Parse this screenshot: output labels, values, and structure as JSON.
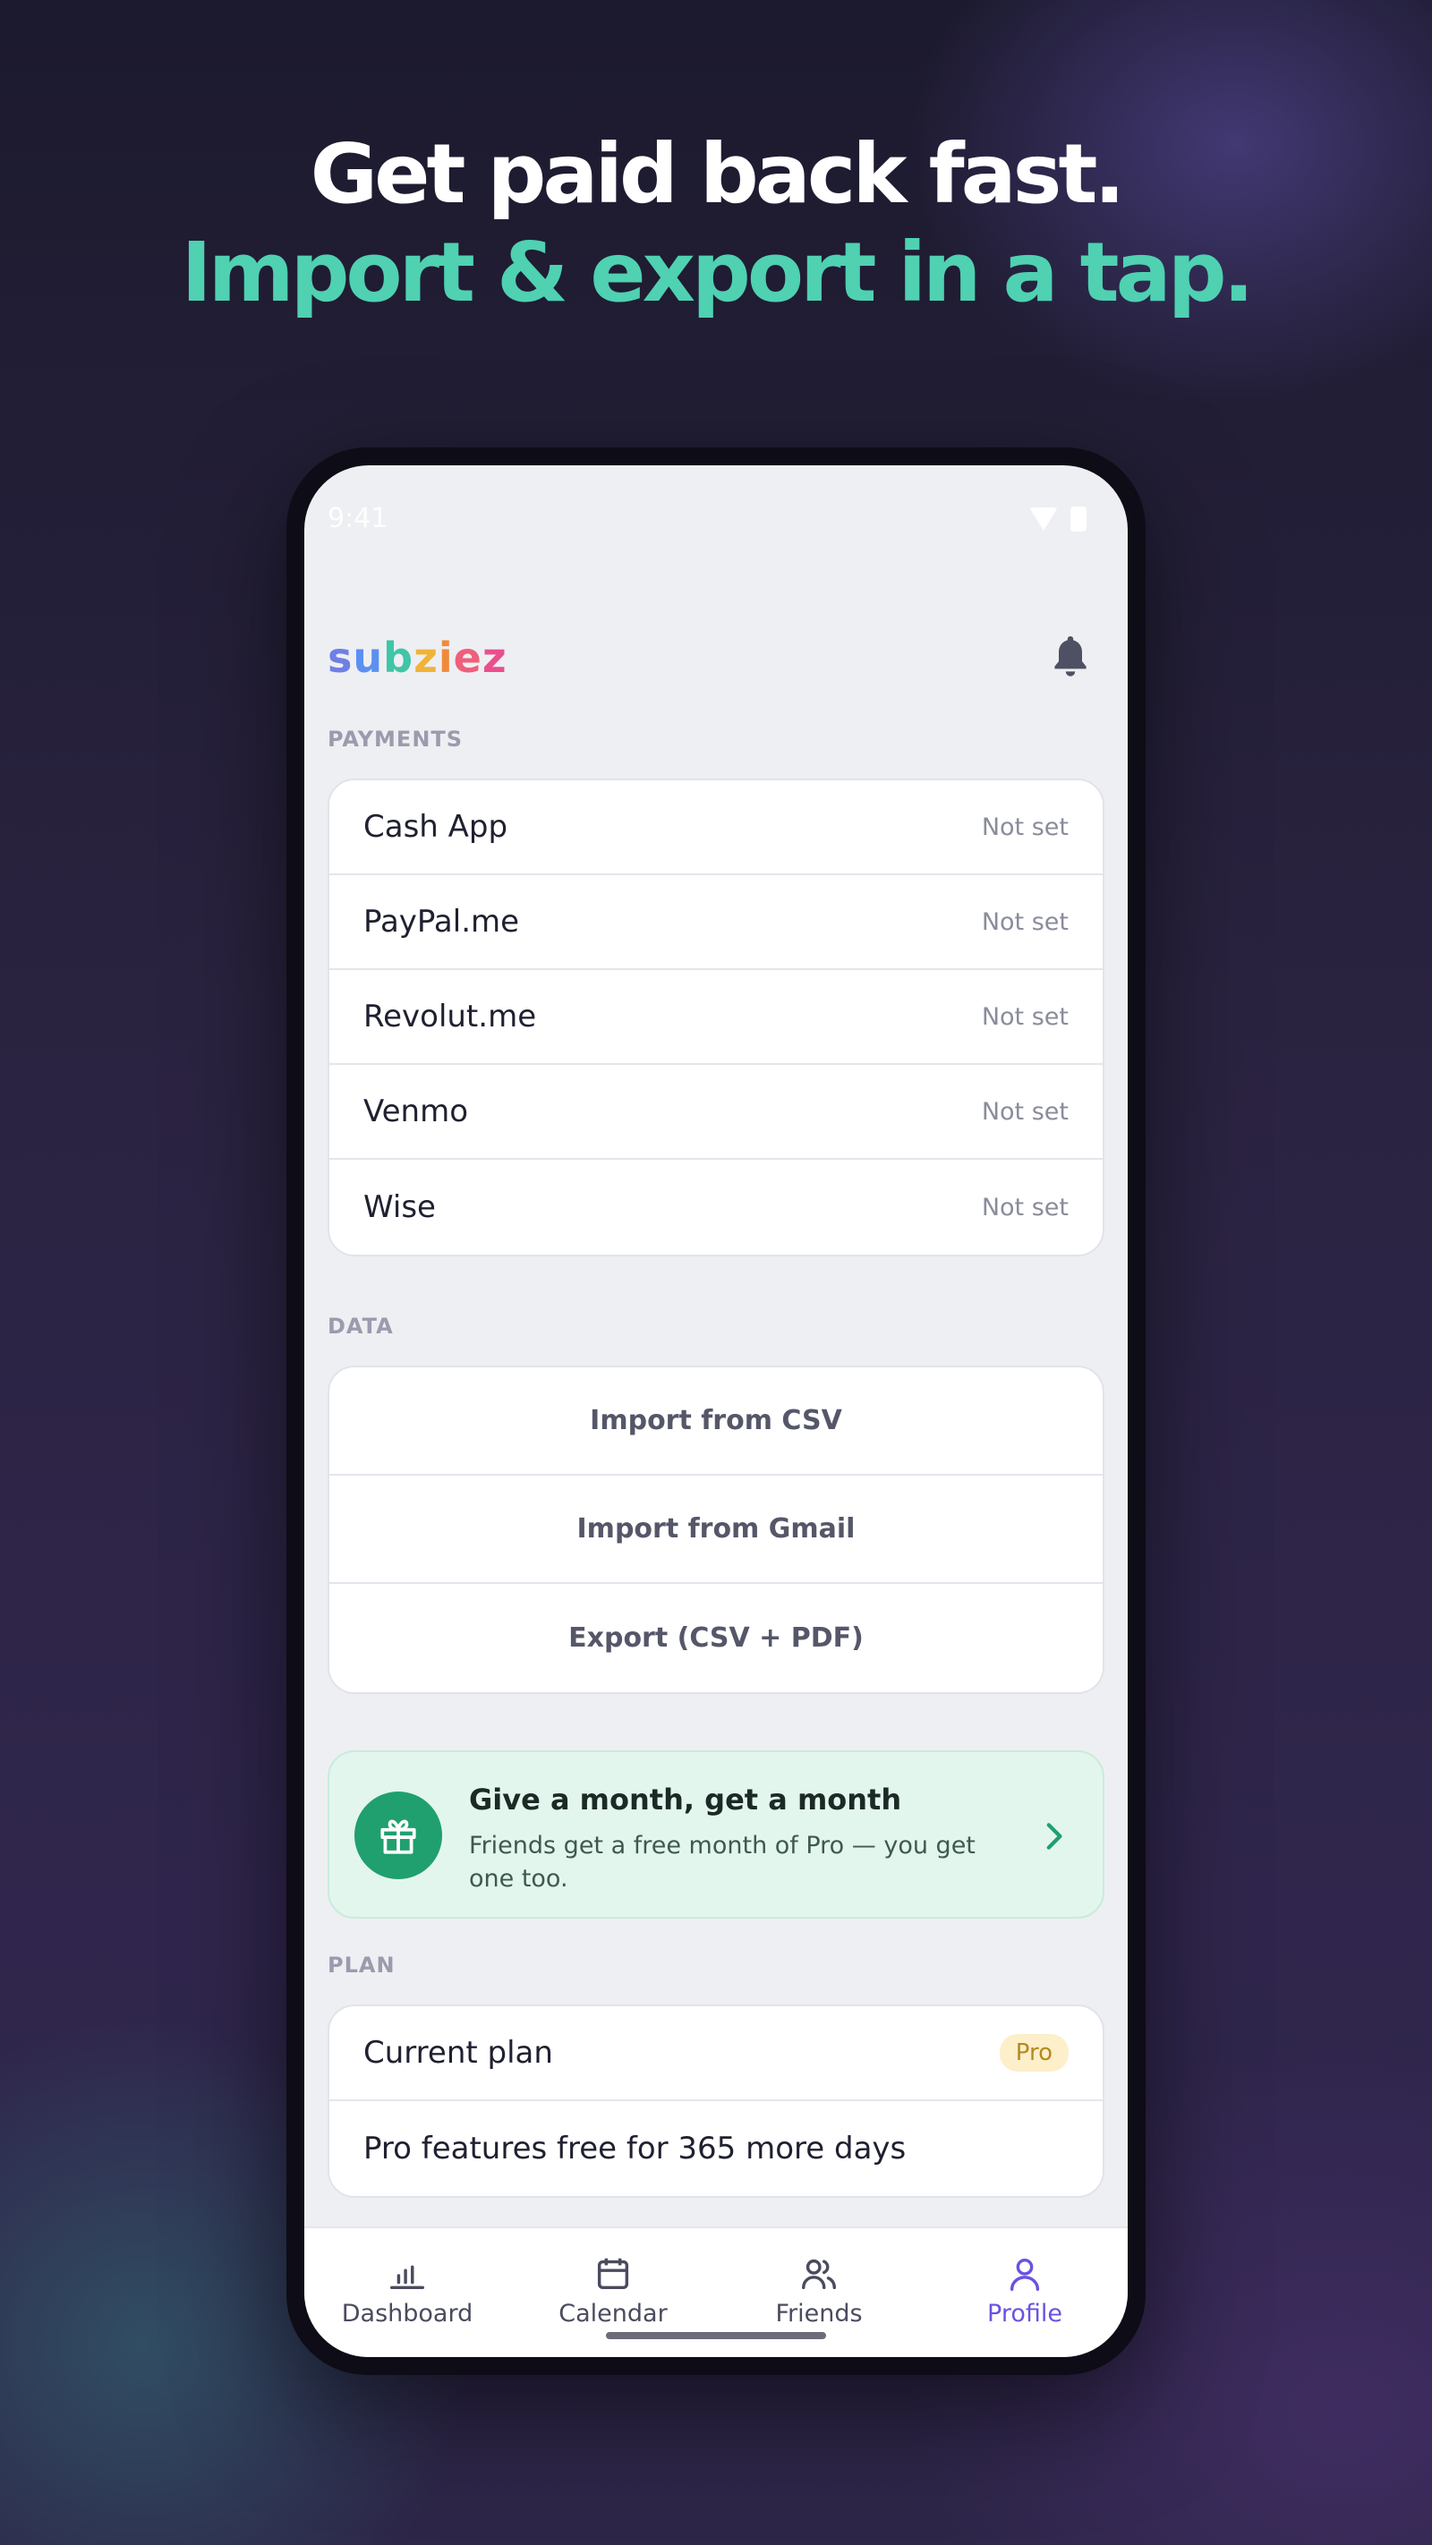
{
  "headline": {
    "line1": "Get paid back fast.",
    "line2": "Import & export in a tap."
  },
  "status_bar": {
    "time": "9:41"
  },
  "app": {
    "logo_letters": [
      "s",
      "u",
      "b",
      "z",
      "i",
      "e",
      "z"
    ]
  },
  "payments": {
    "section_label": "PAYMENTS",
    "items": [
      {
        "label": "Cash App",
        "value": "Not set"
      },
      {
        "label": "PayPal.me",
        "value": "Not set"
      },
      {
        "label": "Revolut.me",
        "value": "Not set"
      },
      {
        "label": "Venmo",
        "value": "Not set"
      },
      {
        "label": "Wise",
        "value": "Not set"
      }
    ]
  },
  "data_section": {
    "section_label": "DATA",
    "actions": [
      {
        "label": "Import from CSV"
      },
      {
        "label": "Import from Gmail"
      },
      {
        "label": "Export (CSV + PDF)"
      }
    ]
  },
  "referral": {
    "title": "Give a month, get a month",
    "subtitle": "Friends get a free month of Pro — you get one too.",
    "icon": "gift-icon"
  },
  "plan": {
    "section_label": "PLAN",
    "current_plan_label": "Current plan",
    "current_plan_badge": "Pro",
    "pro_note": "Pro features free for 365 more days"
  },
  "nav": {
    "items": [
      {
        "label": "Dashboard",
        "icon": "bar-chart-icon",
        "active": false
      },
      {
        "label": "Calendar",
        "icon": "calendar-icon",
        "active": false
      },
      {
        "label": "Friends",
        "icon": "friends-icon",
        "active": false
      },
      {
        "label": "Profile",
        "icon": "profile-icon",
        "active": true
      }
    ]
  },
  "colors": {
    "accent": "#6a52e0",
    "headline_accent": "#4fd1b2",
    "referral_green": "#1fa06e"
  }
}
